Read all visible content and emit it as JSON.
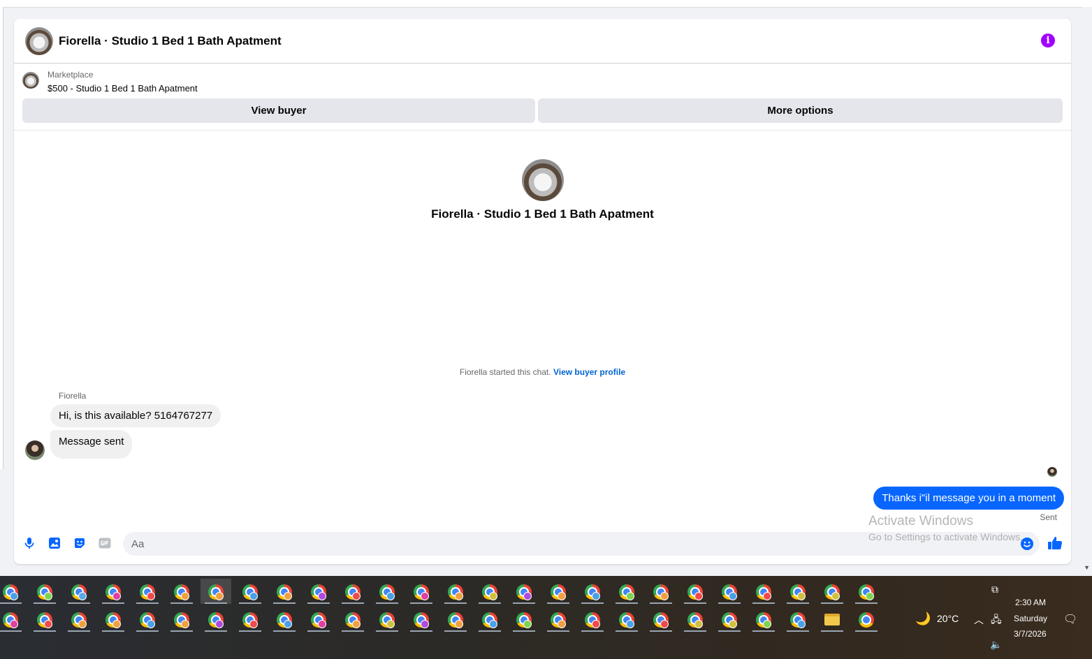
{
  "chat": {
    "title": "Fiorella · Studio 1 Bed 1 Bath Apatment",
    "listing_source": "Marketplace",
    "listing_title": "$500 - Studio 1 Bed 1 Bath Apatment",
    "view_buyer_label": "View buyer",
    "more_options_label": "More options",
    "intro_title": "Fiorella · Studio 1 Bed 1 Bath Apatment",
    "started_text": "Fiorella started this chat.",
    "view_buyer_profile_link": "View buyer profile",
    "sender_name": "Fiorella",
    "messages_in": [
      "Hi, is this available? 5164767277",
      "Message sent"
    ],
    "message_out": "Thanks i\"il message you in a moment",
    "sent_status": "Sent"
  },
  "composer": {
    "placeholder": "Aa"
  },
  "watermark": {
    "title": "Activate Windows",
    "subtitle": "Go to Settings to activate Windows."
  },
  "taskbar": {
    "weather_temp": "20°C",
    "time": "2:30 AM",
    "day": "Saturday",
    "date": "3/7/2026",
    "badge_colors": [
      "#4aa0e8",
      "#7fd34e",
      "#58a9e8",
      "#e040a0",
      "#f04a4a",
      "#f0a040",
      "#f0a040",
      "#4aa0e8",
      "#f0a040",
      "#b04ae0",
      "#f04a4a",
      "#4aa0e8",
      "#e040a0",
      "#f0a040",
      "#d0c040",
      "#b04ae0",
      "#f0a040",
      "#4aa0e8",
      "#7fd34e",
      "#f0a040",
      "#f04a4a",
      "#4aa0e8",
      "#f04a4a",
      "#d0c040",
      "#d0c040",
      "#7fd34e"
    ],
    "accent_blue": "#0866ff",
    "info_purple": "#a100ff"
  }
}
